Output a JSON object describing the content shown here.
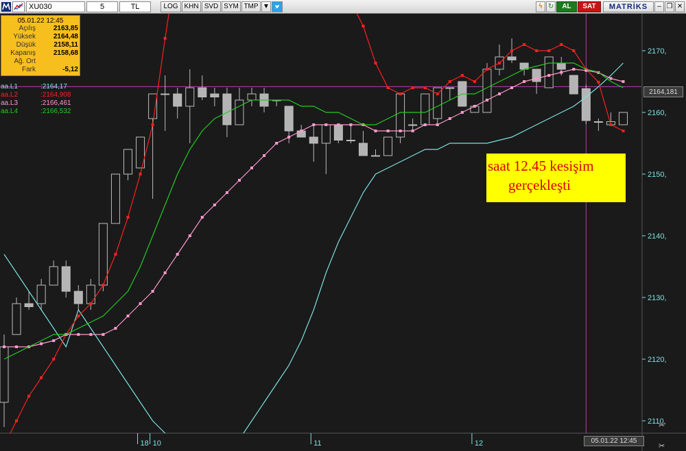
{
  "toolbar": {
    "symbol": "XU030",
    "period": "5",
    "currency": "TL",
    "buttons": [
      "LOG",
      "KHN",
      "SVD",
      "SYM",
      "TMP"
    ],
    "buy_label": "AL",
    "sell_label": "SAT",
    "brand": "MATRİKS"
  },
  "info": {
    "datetime": "05.01.22 12:45",
    "rows": [
      {
        "label": "Açılış",
        "value": "2163,85"
      },
      {
        "label": "Yüksek",
        "value": "2164,48"
      },
      {
        "label": "Düşük",
        "value": "2158,11"
      },
      {
        "label": "Kapanış",
        "value": "2158,68"
      },
      {
        "label": "Ağ. Ort",
        "value": ""
      },
      {
        "label": "Fark",
        "value": "-5,12"
      }
    ]
  },
  "indicators": [
    {
      "name": "aa.L1",
      "value": ":2164,17",
      "color": "#7fe0e0"
    },
    {
      "name": "aa.L2",
      "value": ":2164,908",
      "color": "#ff2020"
    },
    {
      "name": "aa.L3",
      "value": ":2166,461",
      "color": "#ff99cc"
    },
    {
      "name": "aa.L4",
      "value": ":2166,532",
      "color": "#22cc22"
    }
  ],
  "current_price_label": "2164,181",
  "crosshair_time_label": "05.01.22 12:45",
  "annotation": {
    "line1": "saat 12.45 kesişim",
    "line2": "gerçekleşti"
  },
  "chart_data": {
    "type": "candlestick",
    "ylim": [
      2108,
      2176
    ],
    "yticks": [
      2110,
      2120,
      2130,
      2140,
      2150,
      2160,
      2170
    ],
    "ytick_labels": [
      "2110,",
      "2120,",
      "2130,",
      "2140,",
      "2150,",
      "2160,",
      "2170,"
    ],
    "xtick_labels": [
      {
        "label": "18",
        "index": 11
      },
      {
        "label": "10",
        "index": 12
      },
      {
        "label": "11",
        "index": 25
      },
      {
        "label": "12",
        "index": 38
      }
    ],
    "grid": false,
    "candles": [
      {
        "o": 2113,
        "h": 2124,
        "l": 2109,
        "c": 2122
      },
      {
        "o": 2124,
        "h": 2130,
        "l": 2124,
        "c": 2129
      },
      {
        "o": 2129,
        "h": 2131,
        "l": 2128,
        "c": 2128.5
      },
      {
        "o": 2129,
        "h": 2133,
        "l": 2128,
        "c": 2132
      },
      {
        "o": 2132,
        "h": 2136,
        "l": 2132,
        "c": 2135
      },
      {
        "o": 2135,
        "h": 2136,
        "l": 2130,
        "c": 2131
      },
      {
        "o": 2131,
        "h": 2132,
        "l": 2128,
        "c": 2129
      },
      {
        "o": 2129,
        "h": 2133,
        "l": 2128,
        "c": 2132
      },
      {
        "o": 2132,
        "h": 2142,
        "l": 2131,
        "c": 2142
      },
      {
        "o": 2142,
        "h": 2150,
        "l": 2142,
        "c": 2150
      },
      {
        "o": 2150,
        "h": 2154,
        "l": 2149,
        "c": 2154
      },
      {
        "o": 2151,
        "h": 2156,
        "l": 2151,
        "c": 2156
      },
      {
        "o": 2159,
        "h": 2163,
        "l": 2146,
        "c": 2163
      },
      {
        "o": 2163,
        "h": 2166,
        "l": 2157,
        "c": 2163
      },
      {
        "o": 2163,
        "h": 2164,
        "l": 2159,
        "c": 2161
      },
      {
        "o": 2161,
        "h": 2167,
        "l": 2155,
        "c": 2164
      },
      {
        "o": 2164,
        "h": 2166,
        "l": 2162,
        "c": 2162.5
      },
      {
        "o": 2163,
        "h": 2164,
        "l": 2161,
        "c": 2162.5
      },
      {
        "o": 2163,
        "h": 2164,
        "l": 2156,
        "c": 2158
      },
      {
        "o": 2158,
        "h": 2164,
        "l": 2158,
        "c": 2162
      },
      {
        "o": 2162,
        "h": 2164,
        "l": 2161,
        "c": 2163
      },
      {
        "o": 2163,
        "h": 2164,
        "l": 2160,
        "c": 2161
      },
      {
        "o": 2162,
        "h": 2162,
        "l": 2161,
        "c": 2162
      },
      {
        "o": 2161,
        "h": 2161,
        "l": 2155,
        "c": 2157
      },
      {
        "o": 2157,
        "h": 2158,
        "l": 2156,
        "c": 2156
      },
      {
        "o": 2156,
        "h": 2158,
        "l": 2152,
        "c": 2155
      },
      {
        "o": 2155,
        "h": 2158,
        "l": 2150,
        "c": 2158
      },
      {
        "o": 2158,
        "h": 2158,
        "l": 2155,
        "c": 2155.5
      },
      {
        "o": 2155.5,
        "h": 2158,
        "l": 2155,
        "c": 2155.5
      },
      {
        "o": 2155,
        "h": 2157,
        "l": 2153,
        "c": 2153
      },
      {
        "o": 2153,
        "h": 2154,
        "l": 2153,
        "c": 2153
      },
      {
        "o": 2153,
        "h": 2156,
        "l": 2153,
        "c": 2156
      },
      {
        "o": 2156,
        "h": 2163,
        "l": 2155,
        "c": 2163
      },
      {
        "o": 2158,
        "h": 2159,
        "l": 2157,
        "c": 2158
      },
      {
        "o": 2158,
        "h": 2163,
        "l": 2158,
        "c": 2163
      },
      {
        "o": 2159,
        "h": 2164,
        "l": 2158,
        "c": 2164
      },
      {
        "o": 2164,
        "h": 2164,
        "l": 2162,
        "c": 2164
      },
      {
        "o": 2165,
        "h": 2165,
        "l": 2161,
        "c": 2161
      },
      {
        "o": 2160,
        "h": 2161,
        "l": 2160,
        "c": 2161
      },
      {
        "o": 2160,
        "h": 2168,
        "l": 2160,
        "c": 2167
      },
      {
        "o": 2167,
        "h": 2171,
        "l": 2166,
        "c": 2169
      },
      {
        "o": 2169,
        "h": 2172,
        "l": 2168,
        "c": 2168.5
      },
      {
        "o": 2168,
        "h": 2168,
        "l": 2166,
        "c": 2167
      },
      {
        "o": 2167,
        "h": 2167,
        "l": 2163,
        "c": 2165
      },
      {
        "o": 2164,
        "h": 2169,
        "l": 2164,
        "c": 2169
      },
      {
        "o": 2168,
        "h": 2169,
        "l": 2166,
        "c": 2167
      },
      {
        "o": 2166,
        "h": 2166,
        "l": 2163,
        "c": 2163
      },
      {
        "o": 2163.85,
        "h": 2164.48,
        "l": 2158.11,
        "c": 2158.68
      },
      {
        "o": 2158.5,
        "h": 2159,
        "l": 2157,
        "c": 2158.5
      },
      {
        "o": 2158,
        "h": 2160,
        "l": 2158,
        "c": 2158.5
      },
      {
        "o": 2158,
        "h": 2160,
        "l": 2158,
        "c": 2160
      }
    ],
    "series": [
      {
        "name": "aa.L1",
        "color": "#7fe0e0",
        "values": [
          2137,
          2134,
          2131,
          2128,
          2125,
          2122,
          2128,
          2125,
          2122,
          2119,
          2116,
          2113,
          2110,
          2108,
          2106,
          2105,
          2104,
          2104,
          2105,
          2107,
          2110,
          2113,
          2116,
          2119,
          2123,
          2128,
          2134,
          2139,
          2143,
          2147,
          2150,
          2151,
          2152,
          2153,
          2154,
          2154,
          2155,
          2155,
          2155,
          2155,
          2155.5,
          2156,
          2157,
          2158,
          2159,
          2160,
          2161,
          2162.5,
          2164.17,
          2166,
          2168
        ]
      },
      {
        "name": "aa.L2",
        "color": "#ff2020",
        "values": [
          2106,
          2110,
          2114,
          2117,
          2120,
          2124,
          2127,
          2129,
          2132,
          2137,
          2143,
          2150,
          2158,
          2172,
          2185,
          2190,
          2195,
          2199,
          2201,
          2203,
          2203,
          2203,
          2201,
          2199,
          2196,
          2192,
          2188,
          2183,
          2178,
          2174,
          2168,
          2164,
          2163,
          2164,
          2164,
          2163,
          2165,
          2166,
          2165,
          2167,
          2168,
          2170,
          2171,
          2170,
          2170,
          2171,
          2170,
          2167,
          2164.908,
          2158,
          2157
        ]
      },
      {
        "name": "aa.L3",
        "color": "#ff99cc",
        "values": [
          2122,
          2122,
          2122,
          2122.5,
          2123,
          2124,
          2124,
          2124,
          2124,
          2125,
          2127,
          2129,
          2131,
          2134,
          2137,
          2140,
          2143,
          2145,
          2147,
          2149,
          2151,
          2153,
          2155,
          2156,
          2157,
          2158,
          2158,
          2158,
          2158,
          2158,
          2157,
          2157,
          2157,
          2157,
          2158,
          2158,
          2159,
          2160,
          2161,
          2162,
          2163,
          2164,
          2165,
          2165.5,
          2166,
          2166.5,
          2167,
          2166.8,
          2166.461,
          2165.5,
          2165
        ]
      },
      {
        "name": "aa.L4",
        "color": "#22cc22",
        "values": [
          2120,
          2121,
          2122,
          2123,
          2124,
          2124,
          2125,
          2126,
          2127,
          2129,
          2131,
          2135,
          2140,
          2145,
          2150,
          2154,
          2157,
          2159,
          2160,
          2161,
          2162,
          2162,
          2162,
          2162,
          2161,
          2161,
          2160,
          2160,
          2159,
          2158,
          2158,
          2159,
          2160,
          2160,
          2160,
          2161,
          2162,
          2163,
          2163,
          2164,
          2165,
          2166,
          2167,
          2167.5,
          2168,
          2168,
          2168,
          2167,
          2166.532,
          2165,
          2164
        ]
      }
    ]
  }
}
